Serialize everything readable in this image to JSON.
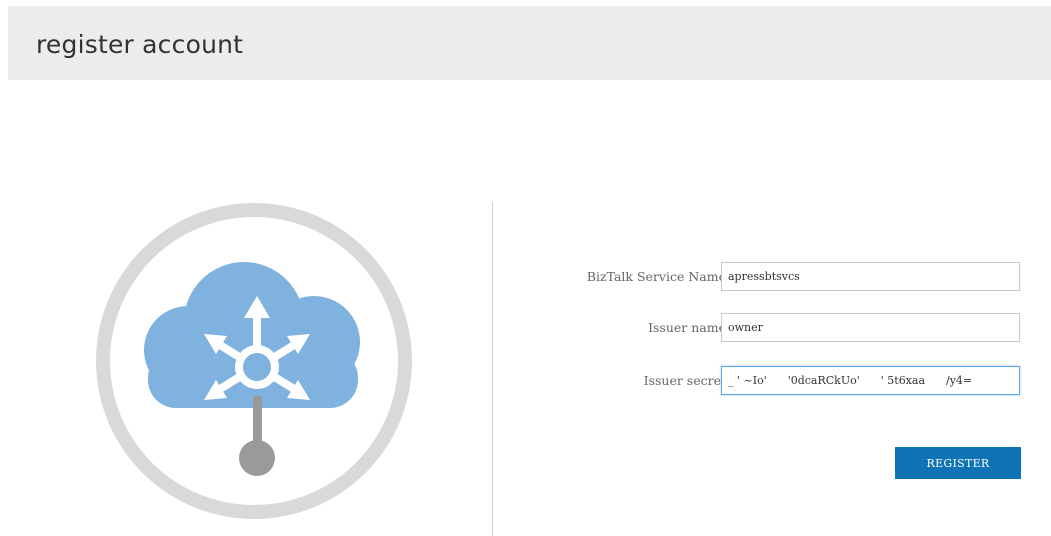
{
  "header": {
    "title": "register account"
  },
  "illustration": {
    "icon": "cloud-hub-icon",
    "colors": {
      "ring": "#d9d9d9",
      "cloud": "#7fb2de",
      "arrows": "#ffffff",
      "stem": "#9a9a9a"
    }
  },
  "form": {
    "fields": [
      {
        "label": "BizTalk Service Name",
        "value": "apressbtsvcs",
        "placeholder": ""
      },
      {
        "label": "Issuer name",
        "value": "owner",
        "placeholder": ""
      },
      {
        "label": "Issuer secret",
        "value": "_ ' ~Io'      '0dcaRCkUo'      ' 5t6xaa      /y4=",
        "placeholder": ""
      }
    ],
    "submit_label": "REGISTER"
  },
  "colors": {
    "header_bg": "#ececec",
    "accent": "#0f73b5",
    "focus_border": "#5aa9e6"
  }
}
